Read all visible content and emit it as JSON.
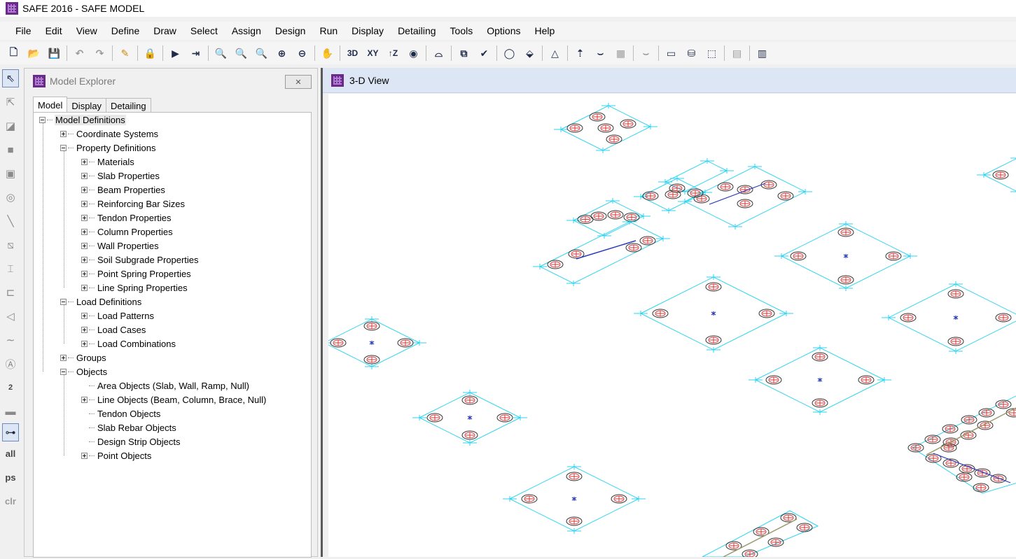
{
  "window": {
    "title": "SAFE 2016 - SAFE MODEL"
  },
  "menu": [
    "File",
    "Edit",
    "View",
    "Define",
    "Draw",
    "Select",
    "Assign",
    "Design",
    "Run",
    "Display",
    "Detailing",
    "Tools",
    "Options",
    "Help"
  ],
  "toolbar": {
    "view3d": "3D",
    "viewxy": "XY",
    "viewz": "↑Z"
  },
  "lefttools": {
    "all": "all",
    "ps": "ps",
    "clr": "clr",
    "num2": "2"
  },
  "explorer": {
    "title": "Model Explorer",
    "close": "✕",
    "tabs": [
      "Model",
      "Display",
      "Detailing"
    ],
    "tree": [
      {
        "label": "Model Definitions",
        "level": 0,
        "expander": "minus",
        "selected": true
      },
      {
        "label": "Coordinate Systems",
        "level": 1,
        "expander": "plus"
      },
      {
        "label": "Property Definitions",
        "level": 1,
        "expander": "minus"
      },
      {
        "label": "Materials",
        "level": 2,
        "expander": "plus"
      },
      {
        "label": "Slab Properties",
        "level": 2,
        "expander": "plus"
      },
      {
        "label": "Beam Properties",
        "level": 2,
        "expander": "plus"
      },
      {
        "label": "Reinforcing Bar Sizes",
        "level": 2,
        "expander": "plus"
      },
      {
        "label": "Tendon Properties",
        "level": 2,
        "expander": "plus"
      },
      {
        "label": "Column Properties",
        "level": 2,
        "expander": "plus"
      },
      {
        "label": "Wall Properties",
        "level": 2,
        "expander": "plus"
      },
      {
        "label": "Soil Subgrade Properties",
        "level": 2,
        "expander": "plus"
      },
      {
        "label": "Point Spring Properties",
        "level": 2,
        "expander": "plus"
      },
      {
        "label": "Line Spring Properties",
        "level": 2,
        "expander": "plus"
      },
      {
        "label": "Load Definitions",
        "level": 1,
        "expander": "minus"
      },
      {
        "label": "Load Patterns",
        "level": 2,
        "expander": "plus"
      },
      {
        "label": "Load Cases",
        "level": 2,
        "expander": "plus"
      },
      {
        "label": "Load Combinations",
        "level": 2,
        "expander": "plus"
      },
      {
        "label": "Groups",
        "level": 1,
        "expander": "plus"
      },
      {
        "label": "Objects",
        "level": 1,
        "expander": "minus"
      },
      {
        "label": "Area Objects (Slab, Wall, Ramp, Null)",
        "level": 2,
        "expander": "none"
      },
      {
        "label": "Line Objects (Beam, Column, Brace, Null)",
        "level": 2,
        "expander": "plus"
      },
      {
        "label": "Tendon Objects",
        "level": 2,
        "expander": "none"
      },
      {
        "label": "Slab Rebar Objects",
        "level": 2,
        "expander": "none"
      },
      {
        "label": "Design Strip Objects",
        "level": 2,
        "expander": "none"
      },
      {
        "label": "Point Objects",
        "level": 2,
        "expander": "plus"
      }
    ]
  },
  "view": {
    "title": "3-D View"
  },
  "colors": {
    "slab": "#2bd3f0",
    "pile": "#d63a3a",
    "beam": "#2a3bb8",
    "strip": "#9a9a6a"
  }
}
